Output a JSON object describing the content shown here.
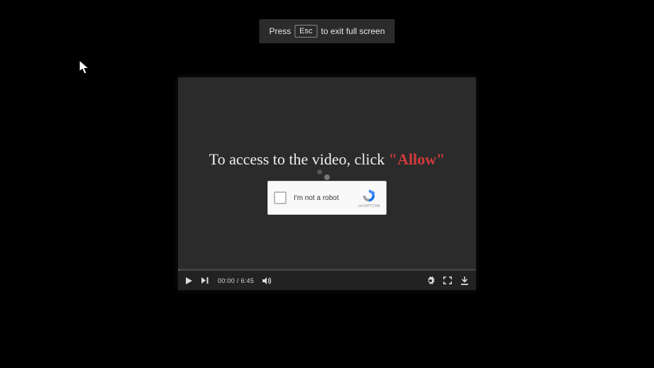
{
  "hint": {
    "press": "Press",
    "key": "Esc",
    "rest": "to exit full screen"
  },
  "prompt": {
    "pre": "To access to the video, click ",
    "allow": "\"Allow\""
  },
  "captcha": {
    "label": "I'm not a robot",
    "brand": "reCAPTCHA"
  },
  "time": {
    "current": "00:00",
    "sep": " / ",
    "total": "6:45"
  }
}
